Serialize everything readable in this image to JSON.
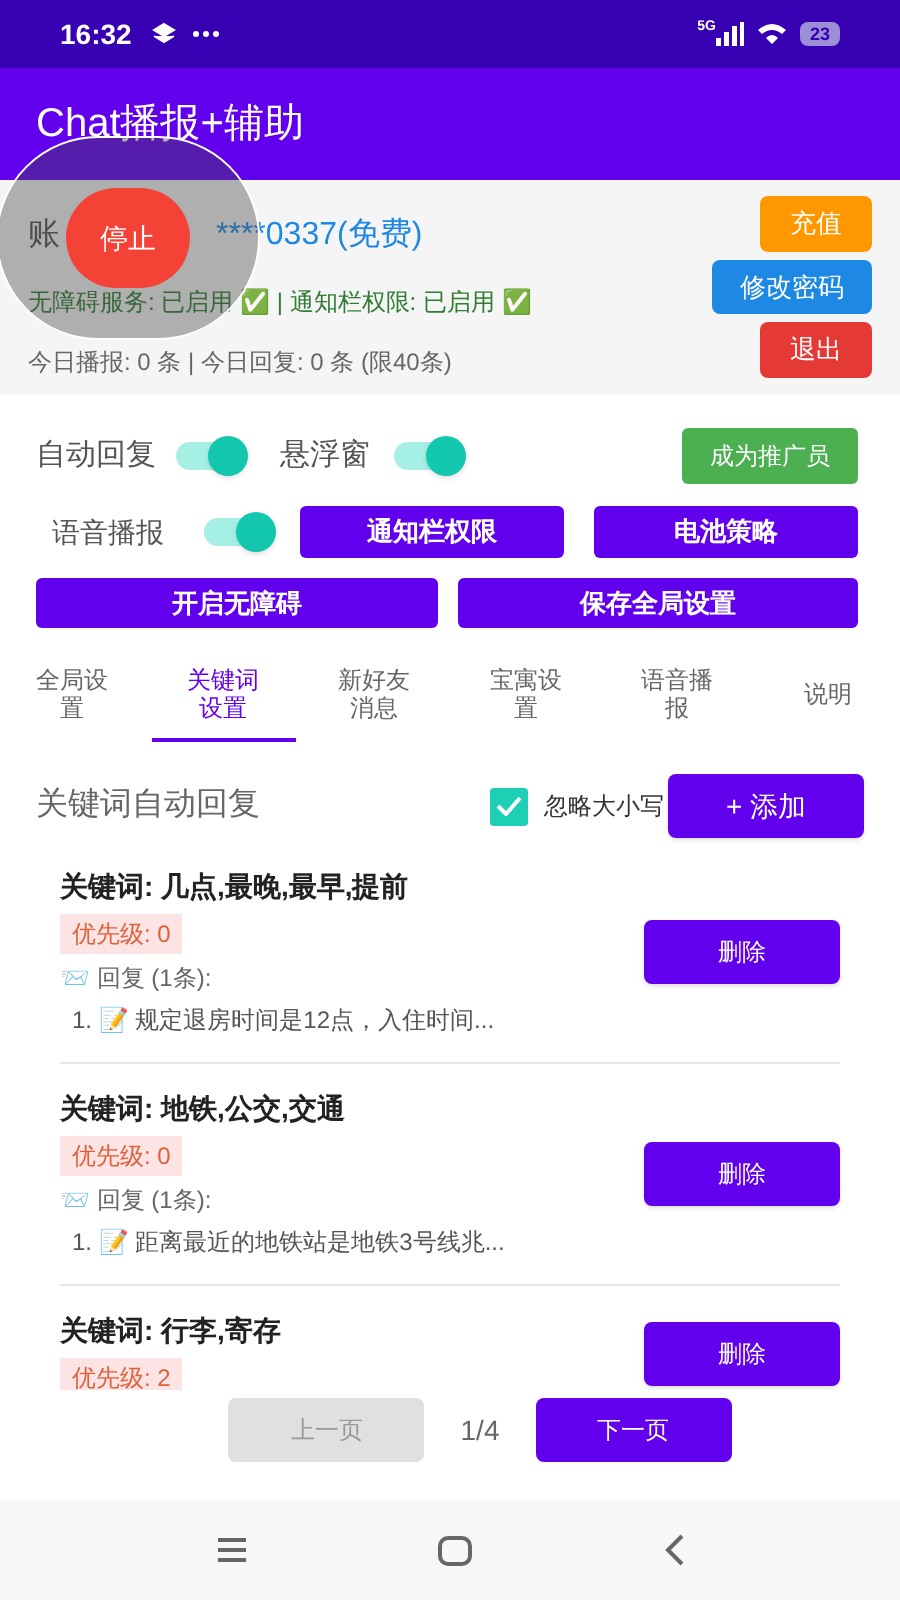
{
  "status_bar": {
    "time": "16:32",
    "network": "5G",
    "battery": "23"
  },
  "app_bar": {
    "title": "Chat播报+辅助"
  },
  "account": {
    "label": "账",
    "value": "****0337(免费)",
    "services": "无障碍服务: 已启用 ✅ | 通知栏权限: 已启用 ✅",
    "stats": "今日播报: 0 条 | 今日回复: 0 条 (限40条)"
  },
  "account_buttons": [
    {
      "label": "充值",
      "color": "#ff9800"
    },
    {
      "label": "修改密码",
      "color": "#1e88e5"
    },
    {
      "label": "退出",
      "color": "#e53935"
    }
  ],
  "floating_bubble": {
    "label": "停止"
  },
  "switches": [
    {
      "label": "自动回复",
      "on": true
    },
    {
      "label": "悬浮窗",
      "on": true
    },
    {
      "label": "语音播报",
      "on": true
    }
  ],
  "promoter_button": "成为推广员",
  "permission_buttons": [
    "通知栏权限",
    "电池策略"
  ],
  "action_buttons": [
    "开启无障碍",
    "保存全局设置"
  ],
  "tabs": [
    {
      "label": "全局设置",
      "selected": false
    },
    {
      "label": "关键词设置",
      "selected": true
    },
    {
      "label": "新好友消息",
      "selected": false
    },
    {
      "label": "宝寓设置",
      "selected": false
    },
    {
      "label": "语音播报",
      "selected": false
    },
    {
      "label": "说明",
      "selected": false
    }
  ],
  "keyword_section": {
    "title": "关键词自动回复",
    "ignore_case": {
      "label": "忽略大小写",
      "checked": true
    },
    "add_button": "+ 添加"
  },
  "rules": [
    {
      "keyword": "关键词: 几点,最晚,最早,提前",
      "priority": "优先级: 0",
      "reply_header": "📨 回复 (1条):",
      "reply": "1. 📝 规定退房时间是12点，入住时间...",
      "delete": "删除"
    },
    {
      "keyword": "关键词: 地铁,公交,交通",
      "priority": "优先级: 0",
      "reply_header": "📨 回复 (1条):",
      "reply": "1. 📝 距离最近的地铁站是地铁3号线兆...",
      "delete": "删除"
    },
    {
      "keyword": "关键词: 行李,寄存",
      "priority": "优先级: 2",
      "delete": "删除"
    }
  ],
  "pagination": {
    "prev": {
      "label": "上一页",
      "disabled": true
    },
    "page": "1/4",
    "next": {
      "label": "下一页",
      "disabled": false
    }
  }
}
